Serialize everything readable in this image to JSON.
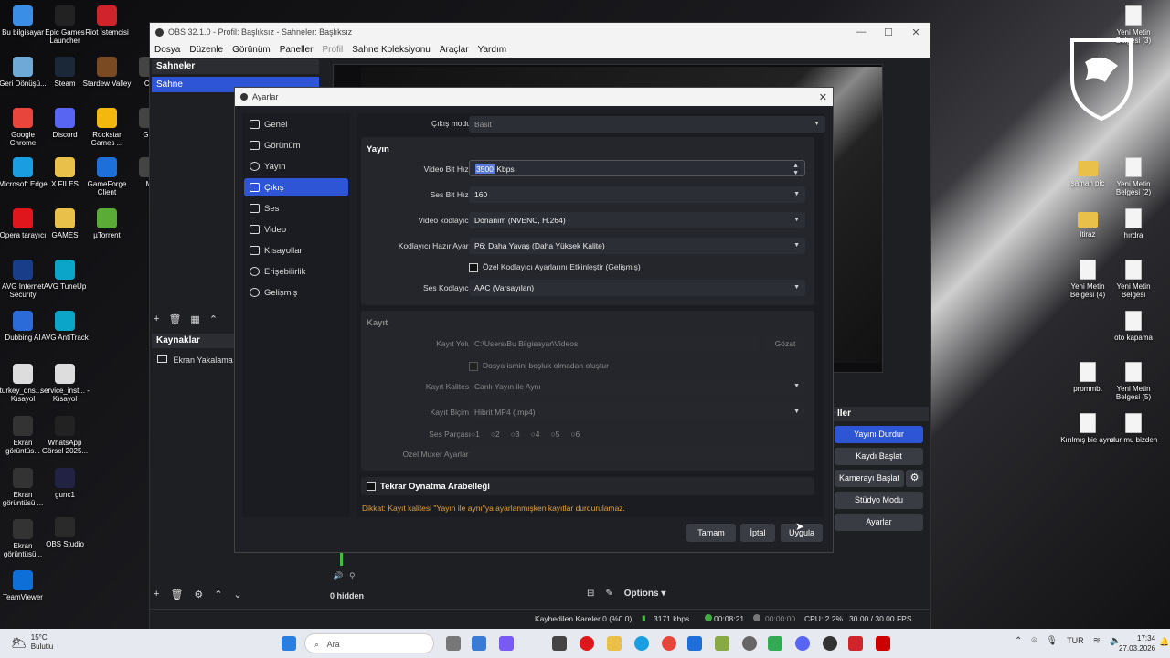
{
  "desktop": {
    "left_icons": [
      {
        "label": "Bu bilgisayar",
        "color": "#3a8ee6"
      },
      {
        "label": "Epic Games Launcher",
        "color": "#222222"
      },
      {
        "label": "Riot İstemcisi",
        "color": "#d0232a"
      },
      {
        "label": "Geri Dönüşü...",
        "color": "#6fa9d8"
      },
      {
        "label": "Steam",
        "color": "#1b2838"
      },
      {
        "label": "Stardew Valley",
        "color": "#7a4a22"
      },
      {
        "label": "Co",
        "color": "#444444"
      },
      {
        "label": "Google Chrome",
        "color": "#e8453c"
      },
      {
        "label": "Discord",
        "color": "#5865f2"
      },
      {
        "label": "Rockstar Games ...",
        "color": "#f2b80d"
      },
      {
        "label": "G A",
        "color": "#444444"
      },
      {
        "label": "Microsoft Edge",
        "color": "#1b9de2"
      },
      {
        "label": "X FILES",
        "color": "#e8c04a"
      },
      {
        "label": "GameForge Client",
        "color": "#1e6fd9"
      },
      {
        "label": "M",
        "color": "#444444"
      },
      {
        "label": "Opera tarayıcı",
        "color": "#e0161d"
      },
      {
        "label": "GAMES",
        "color": "#e8c04a"
      },
      {
        "label": "µTorrent",
        "color": "#5bab37"
      },
      {
        "label": "AVG Internet Security",
        "color": "#1a3d8a"
      },
      {
        "label": "AVG TuneUp",
        "color": "#0aa5c9"
      },
      {
        "label": "Dubbing AI",
        "color": "#2a6bd9"
      },
      {
        "label": "AVG AntiTrack",
        "color": "#0aa5c9"
      },
      {
        "label": "turkey_dns... - Kısayol",
        "color": "#dddddd"
      },
      {
        "label": "service_inst... - Kısayol",
        "color": "#dddddd"
      },
      {
        "label": "Ekran görüntüs...",
        "color": "#333333"
      },
      {
        "label": "WhatsApp Görsel 2025...",
        "color": "#222222"
      },
      {
        "label": "Ekran görüntüsü ...",
        "color": "#333333"
      },
      {
        "label": "gunc1",
        "color": "#222244"
      },
      {
        "label": "Ekran görüntüsü...",
        "color": "#333333"
      },
      {
        "label": "OBS Studio",
        "color": "#2a2a2a"
      },
      {
        "label": "TeamViewer",
        "color": "#0e6fd8"
      }
    ],
    "right_icons": [
      {
        "label": "Yeni Metin Belgesi (3)",
        "type": "doc"
      },
      {
        "label": "şaman pic",
        "type": "folder"
      },
      {
        "label": "Yeni Metin Belgesi (2)",
        "type": "doc"
      },
      {
        "label": "itiraz",
        "type": "folder"
      },
      {
        "label": "hırdra",
        "type": "doc"
      },
      {
        "label": "Yeni Metin Belgesi (4)",
        "type": "doc"
      },
      {
        "label": "Yeni Metin Belgesi",
        "type": "doc"
      },
      {
        "label": "oto kapama",
        "type": "doc"
      },
      {
        "label": "prommbt",
        "type": "doc"
      },
      {
        "label": "Yeni Metin Belgesi (5)",
        "type": "doc"
      },
      {
        "label": "Kırılmış bie ayna",
        "type": "doc"
      },
      {
        "label": "olur mu bizden",
        "type": "doc"
      }
    ]
  },
  "obs": {
    "title": "OBS 32.1.0 - Profil: Başlıksız - Sahneler: Başlıksız",
    "menu": [
      "Dosya",
      "Düzenle",
      "Görünüm",
      "Paneller",
      "Profil",
      "Sahne Koleksiyonu",
      "Araçlar",
      "Yardım"
    ],
    "scenes_title": "Sahneler",
    "scene_item": "Sahne",
    "sources_title": "Kaynaklar",
    "source_item": "Ekran Yakalama",
    "hidden_count": "0 hidden",
    "options_label": "Options",
    "controls_title": "ller",
    "controls": [
      "Yayını Durdur",
      "Kaydı Başlat",
      "Kamerayı Başlat",
      "Stüdyo Modu",
      "Ayarlar"
    ],
    "status": {
      "dropped": "Kaybedilen Kareler 0 (%0.0)",
      "bitrate": "3171 kbps",
      "stream_time": "00:08:21",
      "rec_time": "00:00:00",
      "cpu": "CPU: 2.2%",
      "fps": "30.00 / 30.00 FPS"
    }
  },
  "settings": {
    "title": "Ayarlar",
    "nav": [
      "Genel",
      "Görünüm",
      "Yayın",
      "Çıkış",
      "Ses",
      "Video",
      "Kısayollar",
      "Erişebilirlik",
      "Gelişmiş"
    ],
    "active_nav": "Çıkış",
    "output_mode_label": "Çıkış modu",
    "output_mode_value": "Basit",
    "stream_section": "Yayın",
    "video_bitrate_label": "Video Bit Hızı",
    "video_bitrate_value": "3500",
    "video_bitrate_unit": "Kbps",
    "audio_bitrate_label": "Ses Bit Hızı",
    "audio_bitrate_value": "160",
    "encoder_label": "Video kodlayıcı",
    "encoder_value": "Donanım (NVENC, H.264)",
    "preset_label": "Kodlayıcı Hazır Ayarı",
    "preset_value": "P6: Daha Yavaş (Daha Yüksek Kalite)",
    "custom_encoder_label": "Özel Kodlayıcı Ayarlarını Etkinleştir (Gelişmiş)",
    "audio_encoder_label": "Ses Kodlayıcı",
    "audio_encoder_value": "AAC (Varsayılan)",
    "record_section": "Kayıt",
    "record_path_label": "Kayıt Yolu",
    "record_path_value": "C:\\Users\\Bu Bilgisayar\\Videos",
    "browse_label": "Gözat",
    "no_space_label": "Dosya ismini boşluk olmadan oluştur",
    "quality_label": "Kayıt Kalitesi",
    "quality_value": "Canlı Yayın ile Aynı",
    "format_label": "Kayıt Biçimi",
    "format_value": "Hibrit MP4 (.mp4)",
    "tracks_label": "Ses Parçası",
    "tracks": [
      "1",
      "2",
      "3",
      "4",
      "5",
      "6"
    ],
    "muxer_label": "Özel Muxer Ayarları",
    "replay_label": "Tekrar Oynatma Arabelleği",
    "warning": "Dikkat: Kayıt kalitesi \"Yayın ile aynı\"ya ayarlanmışken kayıtlar durdurulamaz.",
    "ok_button": "Tamam",
    "cancel_button": "İptal",
    "apply_button": "Uygula"
  },
  "taskbar": {
    "temp": "15°C",
    "weather": "Bulutlu",
    "search_placeholder": "Ara",
    "lang": "TUR",
    "time": "17:34",
    "date": "27.03.2026"
  }
}
